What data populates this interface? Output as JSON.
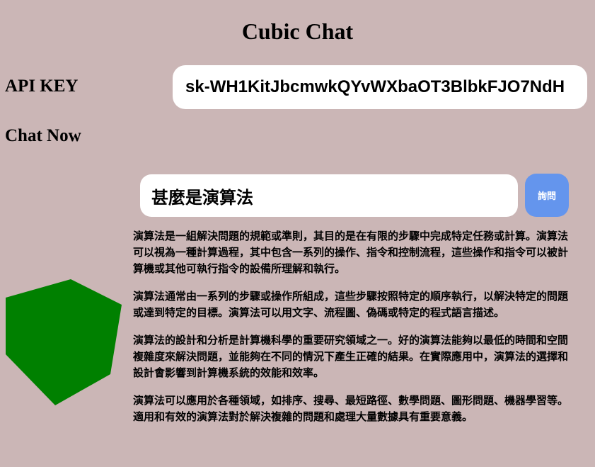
{
  "app": {
    "title": "Cubic Chat"
  },
  "api_key": {
    "label": "API KEY",
    "value": "sk-WH1KitJbcmwkQYvWXbaOT3BlbkFJO7NdH"
  },
  "chat": {
    "label": "Chat Now",
    "question_value": "甚麼是演算法",
    "ask_button_label": "詢問"
  },
  "cube": {
    "color": "#008000"
  },
  "answer": {
    "paragraphs": [
      "演算法是一組解決問題的規範或準則，其目的是在有限的步驟中完成特定任務或計算。演算法可以視為一種計算過程，其中包含一系列的操作、指令和控制流程，這些操作和指令可以被計算機或其他可執行指令的設備所理解和執行。",
      "演算法通常由一系列的步驟或操作所組成，這些步驟按照特定的順序執行，以解決特定的問題或達到特定的目標。演算法可以用文字、流程圖、偽碼或特定的程式語言描述。",
      "演算法的設計和分析是計算機科學的重要研究領域之一。好的演算法能夠以最低的時間和空間複雜度來解決問題，並能夠在不同的情況下產生正確的結果。在實際應用中，演算法的選擇和設計會影響到計算機系統的效能和效率。",
      "演算法可以應用於各種領域，如排序、搜尋、最短路徑、數學問題、圖形問題、機器學習等。適用和有效的演算法對於解決複雜的問題和處理大量數據具有重要意義。"
    ]
  }
}
